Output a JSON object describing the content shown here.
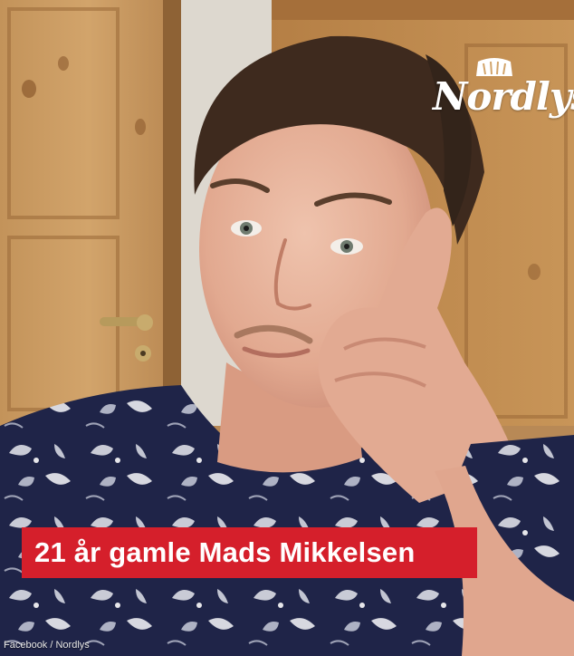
{
  "logo": {
    "text": "Nordlys"
  },
  "caption": {
    "text": "21 år gamle Mads Mikkelsen"
  },
  "credit": {
    "text": "Facebook / Nordlys"
  },
  "colors": {
    "caption_bg": "#d51f2b",
    "logo": "#ffffff",
    "shirt": "#1f2448",
    "door": "#c99a5e"
  }
}
